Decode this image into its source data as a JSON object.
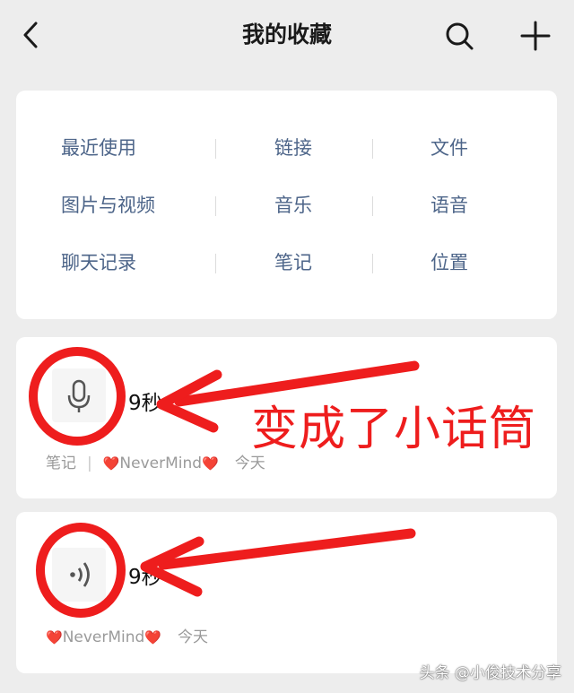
{
  "header": {
    "title": "我的收藏",
    "back_icon": "chevron-left-icon",
    "search_icon": "search-icon",
    "add_icon": "plus-icon"
  },
  "categories": [
    [
      "最近使用",
      "链接",
      "文件"
    ],
    [
      "图片与视频",
      "音乐",
      "语音"
    ],
    [
      "聊天记录",
      "笔记",
      "位置"
    ]
  ],
  "favorites": [
    {
      "icon": "microphone-icon",
      "duration": "9秒",
      "type_label": "笔记",
      "source": "NeverMind",
      "time": "今天"
    },
    {
      "icon": "voice-wave-icon",
      "duration": "9秒",
      "source": "NeverMind",
      "time": "今天"
    }
  ],
  "annotation": {
    "text": "变成了小话筒",
    "color": "#ee1d1d"
  },
  "watermark": "头条 @小俊技术分享",
  "colors": {
    "background": "#ededed",
    "category_text": "#4d6589",
    "meta_text": "#9a9a9a",
    "annotation_red": "#ee1d1d"
  }
}
